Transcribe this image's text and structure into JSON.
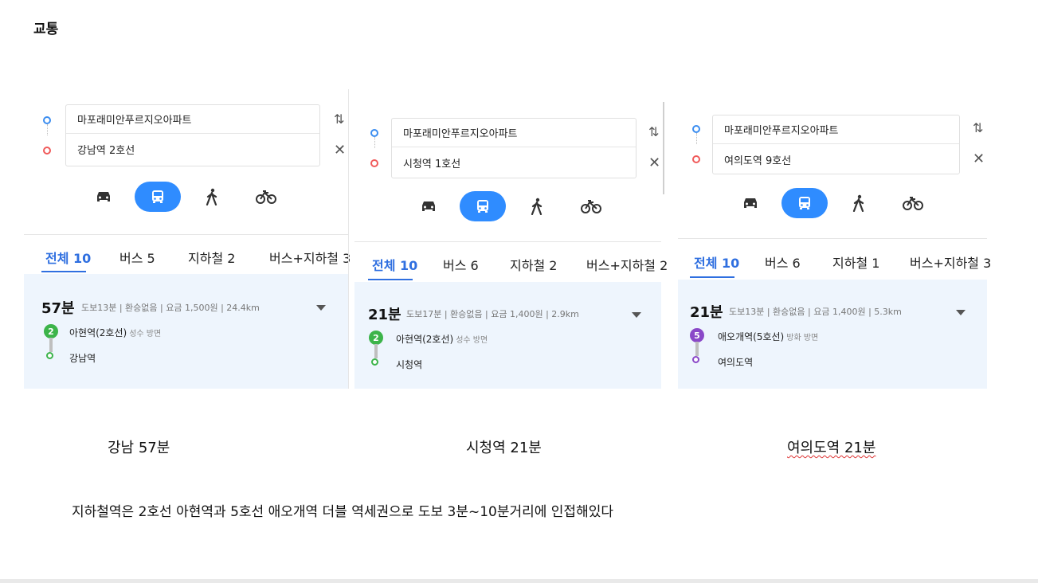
{
  "page": {
    "title": "교통"
  },
  "colors": {
    "accent": "#2f8cff",
    "line2": "#3cb44a",
    "line5": "#8a48c8",
    "origin": "#3b8df0",
    "destination": "#f05a5a"
  },
  "panels": [
    {
      "origin": "마포래미안푸르지오아파트",
      "destination": "강남역 2호선",
      "swap_icon": "swap-arrows-icon",
      "clear_icon": "close-icon",
      "modes": [
        "car-icon",
        "bus-icon",
        "walk-icon",
        "bike-icon"
      ],
      "tabs": [
        "전체 10",
        "버스 5",
        "지하철 2",
        "버스+지하철 3"
      ],
      "result": {
        "time": "57분",
        "meta": "도보13분 | 환승없음 | 요금 1,500원 | 24.4km",
        "line_badge": "2",
        "board_station": "아현역(2호선)",
        "direction": "성수 방면",
        "alight_station": "강남역"
      }
    },
    {
      "origin": "마포래미안푸르지오아파트",
      "destination": "시청역 1호선",
      "swap_icon": "swap-arrows-icon",
      "clear_icon": "close-icon",
      "modes": [
        "car-icon",
        "bus-icon",
        "walk-icon",
        "bike-icon"
      ],
      "tabs": [
        "전체 10",
        "버스 6",
        "지하철 2",
        "버스+지하철 2"
      ],
      "result": {
        "time": "21분",
        "meta": "도보17분 | 환승없음 | 요금 1,400원 | 2.9km",
        "line_badge": "2",
        "board_station": "아현역(2호선)",
        "direction": "성수 방면",
        "alight_station": "시청역"
      }
    },
    {
      "origin": "마포래미안푸르지오아파트",
      "destination": "여의도역 9호선",
      "swap_icon": "swap-arrows-icon",
      "clear_icon": "close-icon",
      "modes": [
        "car-icon",
        "bus-icon",
        "walk-icon",
        "bike-icon"
      ],
      "tabs": [
        "전체 10",
        "버스 6",
        "지하철 1",
        "버스+지하철 3"
      ],
      "result": {
        "time": "21분",
        "meta": "도보13분 | 환승없음 | 요금 1,400원 | 5.3km",
        "line_badge": "5",
        "board_station": "애오개역(5호선)",
        "direction": "방화 방면",
        "alight_station": "여의도역"
      }
    }
  ],
  "captions": [
    "강남 57분",
    "시청역 21분",
    "여의도역 21분"
  ],
  "summary": "지하철역은 2호선 아현역과 5호선 애오개역 더블 역세권으로 도보 3분~10분거리에 인접해있다"
}
